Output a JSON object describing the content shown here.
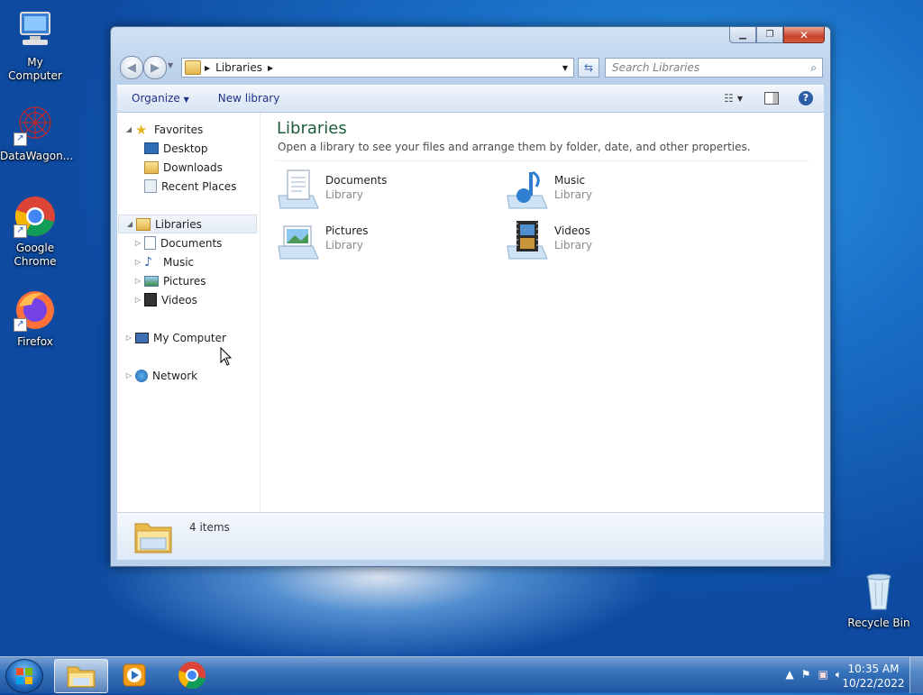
{
  "desktop": {
    "icons": [
      {
        "label": "My Computer"
      },
      {
        "label": "DataWagon..."
      },
      {
        "label": "Google Chrome"
      },
      {
        "label": "Firefox"
      },
      {
        "label": "Recycle Bin"
      }
    ]
  },
  "window": {
    "address": {
      "segments": [
        "Libraries"
      ]
    },
    "search": {
      "placeholder": "Search Libraries"
    },
    "toolbar": {
      "organize": "Organize",
      "new_library": "New library"
    },
    "nav": {
      "favorites": "Favorites",
      "favorites_items": [
        "Desktop",
        "Downloads",
        "Recent Places"
      ],
      "libraries": "Libraries",
      "libraries_items": [
        "Documents",
        "Music",
        "Pictures",
        "Videos"
      ],
      "my_computer": "My Computer",
      "network": "Network"
    },
    "content": {
      "title": "Libraries",
      "subtitle": "Open a library to see your files and arrange them by folder, date, and other properties.",
      "libraries": [
        {
          "name": "Documents",
          "type": "Library"
        },
        {
          "name": "Music",
          "type": "Library"
        },
        {
          "name": "Pictures",
          "type": "Library"
        },
        {
          "name": "Videos",
          "type": "Library"
        }
      ]
    },
    "status": {
      "count": "4 items"
    }
  },
  "taskbar": {
    "clock": {
      "time": "10:35 AM",
      "date": "10/22/2022"
    }
  }
}
